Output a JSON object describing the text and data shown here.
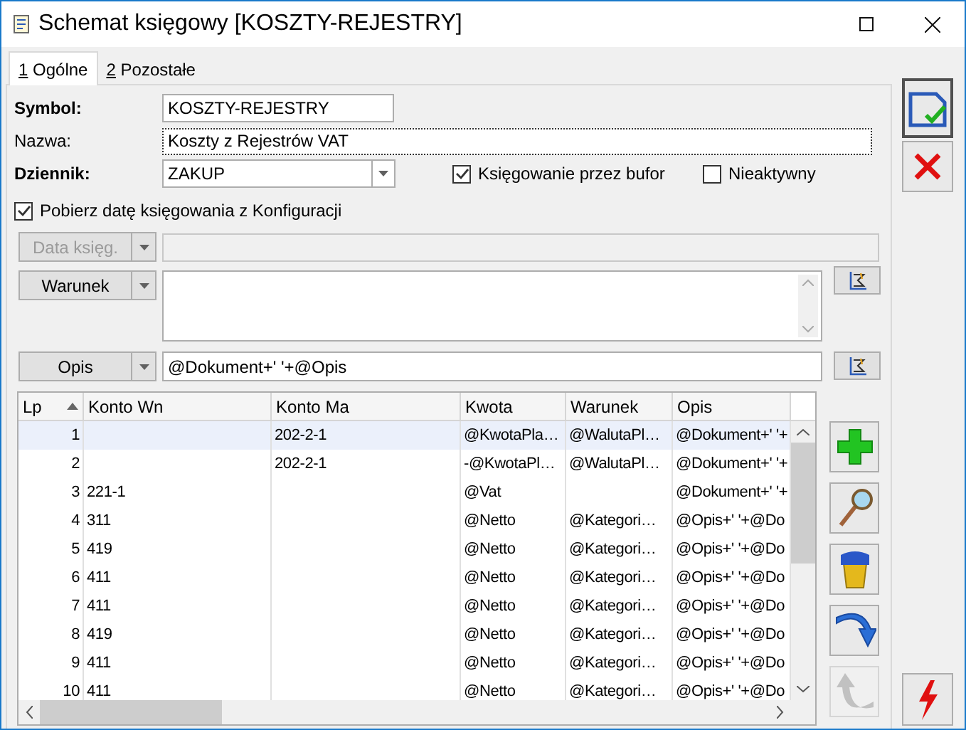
{
  "window": {
    "title": "Schemat księgowy [KOSZTY-REJESTRY]"
  },
  "tabs": [
    {
      "key": "1",
      "label": "Ogólne",
      "selected": true
    },
    {
      "key": "2",
      "label": "Pozostałe",
      "selected": false
    }
  ],
  "form": {
    "symbol": {
      "label": "Symbol:",
      "bold": true,
      "value": "KOSZTY-REJESTRY"
    },
    "nazwa": {
      "label": "Nazwa:",
      "bold": false,
      "value": "Koszty z Rejestrów VAT"
    },
    "dziennik": {
      "label": "Dziennik:",
      "bold": true,
      "value": "ZAKUP"
    },
    "checkboxes": [
      {
        "label": "Księgowanie przez bufor",
        "checked": true
      },
      {
        "label": "Nieaktywny",
        "checked": false
      }
    ],
    "pobierz": {
      "label": "Pobierz datę księgowania z Konfiguracji",
      "checked": true
    },
    "data_ksieg": {
      "label": "Data księg.",
      "disabled": true
    },
    "warunek": {
      "label": "Warunek"
    },
    "opis": {
      "label": "Opis",
      "value": "@Dokument+' '+@Opis"
    }
  },
  "table": {
    "columns": [
      "Lp",
      "Konto Wn",
      "Konto Ma",
      "Kwota",
      "Warunek",
      "Opis"
    ],
    "rows": [
      {
        "cells": [
          "1",
          "",
          "202-2-1",
          "@KwotaPla…",
          "@WalutaPl…",
          "@Dokument+' '+"
        ],
        "selected": true
      },
      {
        "cells": [
          "2",
          "",
          "202-2-1",
          "-@KwotaPl…",
          "@WalutaPl…",
          "@Dokument+' '+"
        ],
        "selected": false
      },
      {
        "cells": [
          "3",
          "221-1",
          "",
          "@Vat",
          "",
          "@Dokument+' '+"
        ],
        "selected": false
      },
      {
        "cells": [
          "4",
          "311",
          "",
          "@Netto",
          "@Kategori…",
          "@Opis+' '+@Do"
        ],
        "selected": false
      },
      {
        "cells": [
          "5",
          "419",
          "",
          "@Netto",
          "@Kategori…",
          "@Opis+' '+@Do"
        ],
        "selected": false
      },
      {
        "cells": [
          "6",
          "411",
          "",
          "@Netto",
          "@Kategori…",
          "@Opis+' '+@Do"
        ],
        "selected": false
      },
      {
        "cells": [
          "7",
          "411",
          "",
          "@Netto",
          "@Kategori…",
          "@Opis+' '+@Do"
        ],
        "selected": false
      },
      {
        "cells": [
          "8",
          "419",
          "",
          "@Netto",
          "@Kategori…",
          "@Opis+' '+@Do"
        ],
        "selected": false
      },
      {
        "cells": [
          "9",
          "411",
          "",
          "@Netto",
          "@Kategori…",
          "@Opis+' '+@Do"
        ],
        "selected": false
      },
      {
        "cells": [
          "10",
          "411",
          "",
          "@Netto",
          "@Kategori…",
          "@Opis+' '+@Do"
        ],
        "selected": false
      }
    ]
  },
  "side_buttons": [
    {
      "kind": "add",
      "disabled": false
    },
    {
      "kind": "view",
      "disabled": false
    },
    {
      "kind": "delete",
      "disabled": false
    },
    {
      "kind": "redo",
      "disabled": false
    },
    {
      "kind": "undo",
      "disabled": true
    }
  ]
}
